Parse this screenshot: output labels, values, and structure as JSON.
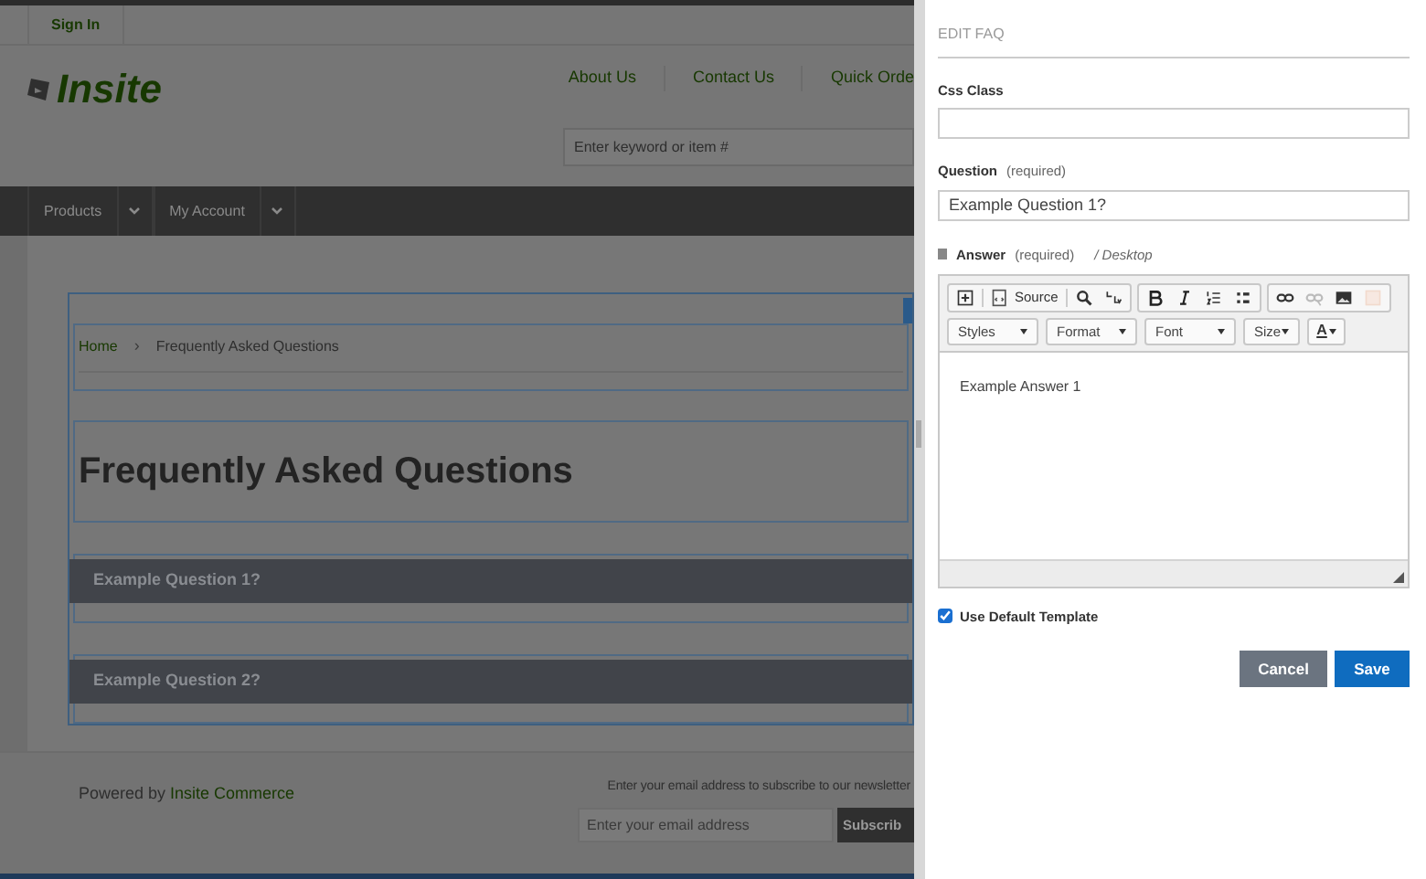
{
  "site": {
    "sign_in": "Sign In",
    "logo": "Insite",
    "nav_links": [
      "About Us",
      "Contact Us",
      "Quick Orde"
    ],
    "search": {
      "placeholder": "Enter keyword or item #"
    },
    "menu": [
      "Products",
      "My Account"
    ],
    "breadcrumb": [
      "Home",
      "Frequently Asked Questions"
    ],
    "breadcrumb_separator": "›",
    "title": "Frequently Asked Questions",
    "faqs": [
      "Example Question 1?",
      "Example Question 2?"
    ],
    "footer": {
      "powered_by": "Powered by",
      "powered_link": "Insite Commerce",
      "newsletter": "Enter your email address to subscribe to our newsletter",
      "email": {
        "placeholder": "Enter your email address"
      },
      "subscribe": "Subscrib"
    }
  },
  "panel": {
    "title": "EDIT FAQ",
    "css_class": {
      "label": "Css Class"
    },
    "question": {
      "label": "Question",
      "note": "(required)",
      "value": "Example Question 1?"
    },
    "answer": {
      "label": "Answer",
      "note": "(required)",
      "device": "/ Desktop"
    },
    "toolbar": [
      [
        {
          "kind": "new-page",
          "disabled": false
        }
      ],
      [
        {
          "kind": "source",
          "label": "Source",
          "disabled": false
        }
      ],
      [
        {
          "kind": "find",
          "disabled": false
        },
        {
          "kind": "replace",
          "disabled": false
        }
      ],
      [
        {
          "kind": "bold",
          "disabled": false
        },
        {
          "kind": "italic",
          "disabled": false
        },
        {
          "kind": "numbered-list",
          "disabled": false
        },
        {
          "kind": "bulleted-list",
          "disabled": false
        }
      ],
      [
        {
          "kind": "link",
          "disabled": false
        },
        {
          "kind": "unlink",
          "disabled": true
        },
        {
          "kind": "image",
          "disabled": false
        },
        {
          "kind": "frame",
          "disabled": true
        }
      ]
    ],
    "dropdowns": [
      "Styles",
      "Format",
      "Font",
      "Size"
    ],
    "text_color": "A",
    "answer_text": "Example Answer 1",
    "use_default_template": {
      "label": "Use Default Template",
      "checked": true
    },
    "buttons": [
      "Cancel",
      "Save"
    ]
  }
}
